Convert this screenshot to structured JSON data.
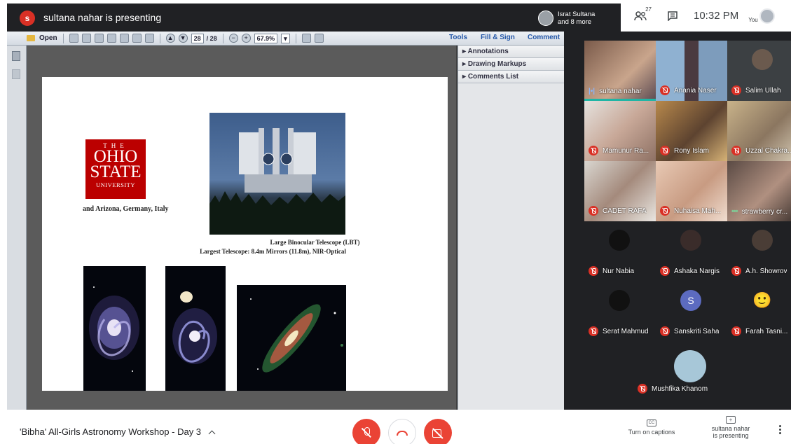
{
  "topbar": {
    "presenter_initial": "s",
    "presenting_text": "sultana nahar is presenting",
    "viewers_line1": "Israt Sultana",
    "viewers_line2": "and 8 more",
    "people_count": "27",
    "clock": "10:32 PM",
    "you_label": "You"
  },
  "pdf": {
    "open_label": "Open",
    "page_current": "28",
    "page_total": "/ 28",
    "zoom": "67.9%",
    "menu_tools": "Tools",
    "menu_fill_sign": "Fill & Sign",
    "menu_comment": "Comment",
    "panel_items": [
      "Annotations",
      "Drawing Markups",
      "Comments List"
    ]
  },
  "slide": {
    "logo_the": "THE",
    "logo_ohio": "OHIO",
    "logo_state": "STATE",
    "logo_university": "UNIVERSITY",
    "osu_caption": "and Arizona, Germany, Italy",
    "lbt_caption1": "Large Binocular Telescope (LBT)",
    "lbt_caption2": "Largest Telescope: 8.4m Mirrors (11.8m), NIR-Optical"
  },
  "participants": [
    {
      "name": "sultana nahar",
      "status": "speaking"
    },
    {
      "name": "Anania Naser",
      "status": "muted"
    },
    {
      "name": "Salim Ullah",
      "status": "muted"
    },
    {
      "name": "Mamunur Ra...",
      "status": "muted"
    },
    {
      "name": "Rony Islam",
      "status": "muted"
    },
    {
      "name": "Uzzal Chakra...",
      "status": "muted"
    },
    {
      "name": "CADET RAFA",
      "status": "muted"
    },
    {
      "name": "Nuhaisa Mah...",
      "status": "muted"
    },
    {
      "name": "strawberry cr...",
      "status": "more"
    },
    {
      "name": "Nur Nabia",
      "status": "muted"
    },
    {
      "name": "Ashaka Nargis",
      "status": "muted"
    },
    {
      "name": "A.h. Showrov",
      "status": "muted"
    },
    {
      "name": "Serat Mahmud",
      "status": "muted"
    },
    {
      "name": "Sanskriti Saha",
      "status": "muted",
      "initial": "S"
    },
    {
      "name": "Farah Tasni...",
      "status": "muted",
      "emoji": "🙂"
    },
    {
      "name": "Mushfika Khanom",
      "status": "muted"
    }
  ],
  "bottombar": {
    "meeting_title": "'Bibha' All-Girls Astronomy Workshop - Day 3",
    "captions_icon_text": "CC",
    "captions_label": "Turn on captions",
    "presenting_line1": "sultana nahar",
    "presenting_line2": "is presenting"
  },
  "colors": {
    "meet_red": "#ea4335",
    "osu_red": "#bb0000",
    "dark_bg": "#202124"
  }
}
